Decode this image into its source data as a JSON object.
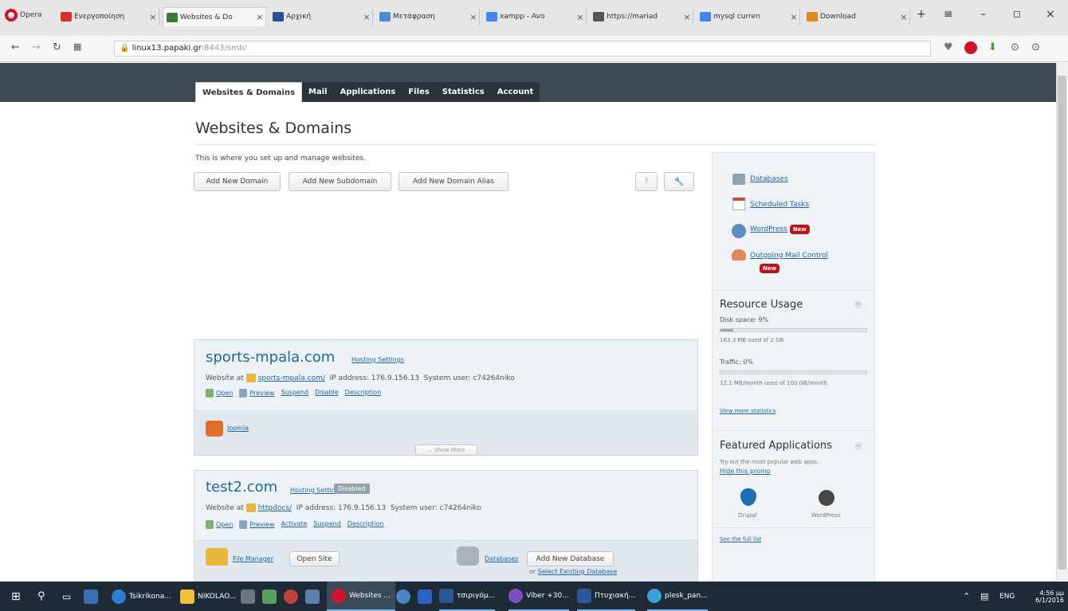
{
  "browser": {
    "brand": "Opera",
    "tabs": [
      {
        "title": "Ενεργοποίηση",
        "color": "#d93025"
      },
      {
        "title": "Websites & Do",
        "color": "#3b7a3a"
      },
      {
        "title": "Αρχική",
        "color": "#2a4f9a"
      },
      {
        "title": "Μετάφραση",
        "color": "#4a8ad4"
      },
      {
        "title": "xampp - Avo",
        "color": "#4285f4"
      },
      {
        "title": "https://mariad",
        "color": "#555555"
      },
      {
        "title": "mysql curren",
        "color": "#4285f4"
      },
      {
        "title": "Download",
        "color": "#e38a1c"
      }
    ],
    "url_host": "linux13.papaki.gr",
    "url_rest": ":8443/smb/"
  },
  "plesk": {
    "nav_tabs": [
      "Websites & Domains",
      "Mail",
      "Applications",
      "Files",
      "Statistics",
      "Account"
    ],
    "page_title": "Websites & Domains",
    "intro": "This is where you set up and manage websites.",
    "buttons": {
      "add_domain": "Add New Domain",
      "add_subdomain": "Add New Subdomain",
      "add_alias": "Add New Domain Alias",
      "help": "?",
      "tools": "🔧"
    },
    "domains": [
      {
        "name": "sports-mpala.com",
        "hosting": "Hosting Settings",
        "website_at": "Website at",
        "folder": "sports-mpala.com/",
        "ip": "IP address: 176.9.156.13",
        "user": "System user: c74264niko",
        "actions": [
          "Open",
          "Preview",
          "Suspend",
          "Disable",
          "Description"
        ],
        "app": "Joomla",
        "show_more": "Show More"
      },
      {
        "name": "test2.com",
        "hosting": "Hosting Settings",
        "badge": "Disabled",
        "website_at": "Website at",
        "folder": "httpdocs/",
        "ip": "IP address: 176.9.156.13",
        "user": "System user: c74264niko",
        "actions": [
          "Open",
          "Preview",
          "Activate",
          "Suspend",
          "Description"
        ],
        "file_manager": "File Manager",
        "open_site": "Open Site",
        "databases": "Databases",
        "add_db": "Add New Database",
        "or": "or",
        "select_db": "Select Existing Database"
      }
    ],
    "sidebar": {
      "links": [
        "Databases",
        "Scheduled Tasks",
        "WordPress",
        "Outgoing Mail Control"
      ],
      "new_badge": "New",
      "resource_title": "Resource Usage",
      "disk_label": "Disk space: 9%",
      "disk_pct": 9,
      "disk_detail": "183.3 MB used of 2 GB",
      "traffic_label": "Traffic: 0%",
      "traffic_pct": 0,
      "traffic_detail": "12.1 MB/month used of 100 GB/month",
      "view_stats": "View more statistics",
      "featured_title": "Featured Applications",
      "featured_text": "Try out the most popular web apps.",
      "hide_promo": "Hide this promo",
      "apps": [
        "Drupal",
        "WordPress"
      ],
      "see_full": "See the full list"
    }
  },
  "taskbar": {
    "items": [
      "Tsikrikona...",
      "NIKOLAO...",
      "Websites ...",
      "τσιριγόμ...",
      "Viber +30...",
      "Πτυχιακή...",
      "plesk_pan..."
    ],
    "lang": "ENG",
    "time": "4:56 μμ",
    "date": "6/1/2016"
  }
}
